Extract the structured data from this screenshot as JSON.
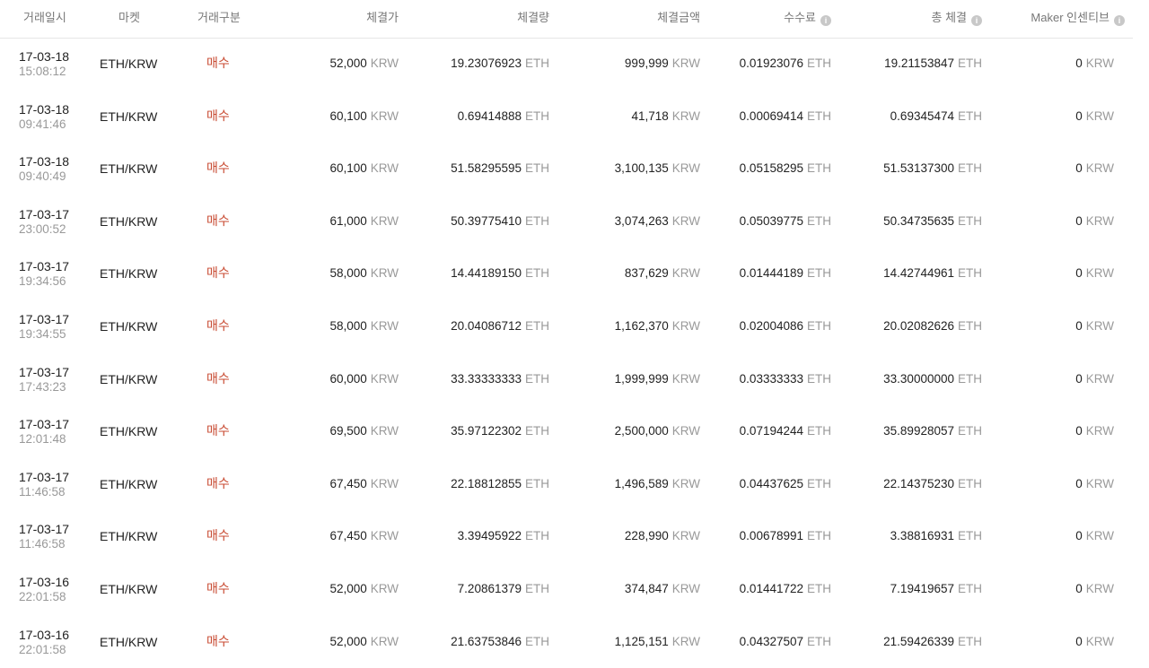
{
  "headers": {
    "date": "거래일시",
    "market": "마켓",
    "side": "거래구분",
    "price": "체결가",
    "volume": "체결량",
    "amount": "체결금액",
    "fee": "수수료",
    "total": "총 체결",
    "maker": "Maker 인센티브",
    "info_icon": "i"
  },
  "units": {
    "krw": "KRW",
    "eth": "ETH"
  },
  "rows": [
    {
      "date": "17-03-18",
      "time": "15:08:12",
      "market": "ETH/KRW",
      "side": "매수",
      "price": "52,000",
      "volume": "19.23076923",
      "amount": "999,999",
      "fee": "0.01923076",
      "total": "19.21153847",
      "maker": "0"
    },
    {
      "date": "17-03-18",
      "time": "09:41:46",
      "market": "ETH/KRW",
      "side": "매수",
      "price": "60,100",
      "volume": "0.69414888",
      "amount": "41,718",
      "fee": "0.00069414",
      "total": "0.69345474",
      "maker": "0"
    },
    {
      "date": "17-03-18",
      "time": "09:40:49",
      "market": "ETH/KRW",
      "side": "매수",
      "price": "60,100",
      "volume": "51.58295595",
      "amount": "3,100,135",
      "fee": "0.05158295",
      "total": "51.53137300",
      "maker": "0"
    },
    {
      "date": "17-03-17",
      "time": "23:00:52",
      "market": "ETH/KRW",
      "side": "매수",
      "price": "61,000",
      "volume": "50.39775410",
      "amount": "3,074,263",
      "fee": "0.05039775",
      "total": "50.34735635",
      "maker": "0"
    },
    {
      "date": "17-03-17",
      "time": "19:34:56",
      "market": "ETH/KRW",
      "side": "매수",
      "price": "58,000",
      "volume": "14.44189150",
      "amount": "837,629",
      "fee": "0.01444189",
      "total": "14.42744961",
      "maker": "0"
    },
    {
      "date": "17-03-17",
      "time": "19:34:55",
      "market": "ETH/KRW",
      "side": "매수",
      "price": "58,000",
      "volume": "20.04086712",
      "amount": "1,162,370",
      "fee": "0.02004086",
      "total": "20.02082626",
      "maker": "0"
    },
    {
      "date": "17-03-17",
      "time": "17:43:23",
      "market": "ETH/KRW",
      "side": "매수",
      "price": "60,000",
      "volume": "33.33333333",
      "amount": "1,999,999",
      "fee": "0.03333333",
      "total": "33.30000000",
      "maker": "0"
    },
    {
      "date": "17-03-17",
      "time": "12:01:48",
      "market": "ETH/KRW",
      "side": "매수",
      "price": "69,500",
      "volume": "35.97122302",
      "amount": "2,500,000",
      "fee": "0.07194244",
      "total": "35.89928057",
      "maker": "0"
    },
    {
      "date": "17-03-17",
      "time": "11:46:58",
      "market": "ETH/KRW",
      "side": "매수",
      "price": "67,450",
      "volume": "22.18812855",
      "amount": "1,496,589",
      "fee": "0.04437625",
      "total": "22.14375230",
      "maker": "0"
    },
    {
      "date": "17-03-17",
      "time": "11:46:58",
      "market": "ETH/KRW",
      "side": "매수",
      "price": "67,450",
      "volume": "3.39495922",
      "amount": "228,990",
      "fee": "0.00678991",
      "total": "3.38816931",
      "maker": "0"
    },
    {
      "date": "17-03-16",
      "time": "22:01:58",
      "market": "ETH/KRW",
      "side": "매수",
      "price": "52,000",
      "volume": "7.20861379",
      "amount": "374,847",
      "fee": "0.01441722",
      "total": "7.19419657",
      "maker": "0"
    },
    {
      "date": "17-03-16",
      "time": "22:01:58",
      "market": "ETH/KRW",
      "side": "매수",
      "price": "52,000",
      "volume": "21.63753846",
      "amount": "1,125,151",
      "fee": "0.04327507",
      "total": "21.59426339",
      "maker": "0"
    }
  ]
}
